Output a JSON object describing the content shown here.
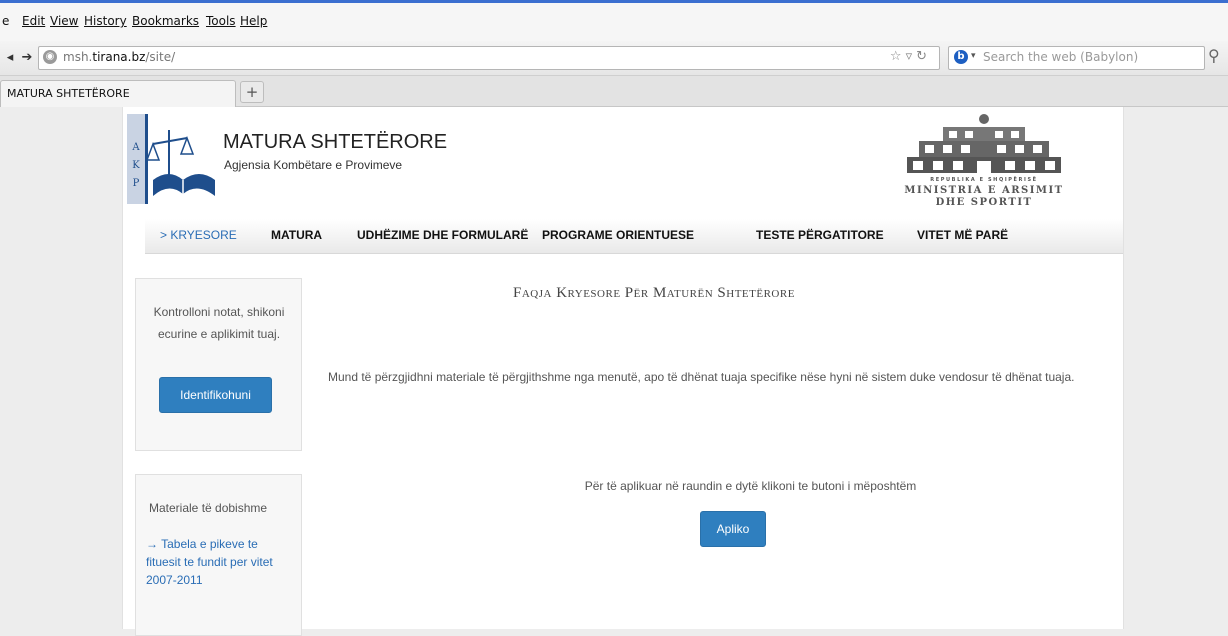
{
  "browser": {
    "menu": [
      "e",
      "Edit",
      "View",
      "History",
      "Bookmarks",
      "Tools",
      "Help"
    ],
    "url_host": "msh.tirana.bz",
    "url_path": "/site/",
    "url_prefix": "msh.",
    "url_domain": "tirana.bz",
    "search_placeholder": "Search the web (Babylon)",
    "tab_title": "MATURA SHTETËRORE",
    "new_tab": "+"
  },
  "header": {
    "logo_letters": [
      "A",
      "K",
      "P"
    ],
    "title": "MATURA SHTETËRORE",
    "subtitle": "Agjensia Kombëtare e Provimeve",
    "ministry_small": "REPUBLIKA E SHQIPËRISË",
    "ministry_line1": "MINISTRIA E ARSIMIT",
    "ministry_line2": "DHE SPORTIT"
  },
  "nav": [
    {
      "label": "> KRYESORE",
      "active": true
    },
    {
      "label": "MATURA"
    },
    {
      "label": "UDHËZIME DHE FORMULARË"
    },
    {
      "label": "PROGRAME ORIENTUESE"
    },
    {
      "label": "TESTE PËRGATITORE"
    },
    {
      "label": "VITET MË PARË"
    }
  ],
  "sidebar": {
    "login_text": "Kontrolloni notat, shikoni ecurine e aplikimit tuaj.",
    "login_button": "Identifikohuni",
    "materials_title": "Materiale të dobishme",
    "materials_link": "→ Tabela e pikeve te fituesit te fundit per vitet 2007-2011"
  },
  "main": {
    "title": "Faqja Kryesore Për Maturën Shtetërore",
    "intro": "Mund të përzgjidhni materiale të përgjithshme nga menutë, apo të dhënat tuaja specifike nëse hyni në sistem duke vendosur të dhënat tuaja.",
    "apply_note": "Për të aplikuar në raundin e dytë klikoni te butoni i mëposhtëm",
    "apply_button": "Apliko"
  },
  "colors": {
    "accent": "#2f7fbf",
    "link": "#2a6db5",
    "logo_blue": "#1f4e8c"
  }
}
